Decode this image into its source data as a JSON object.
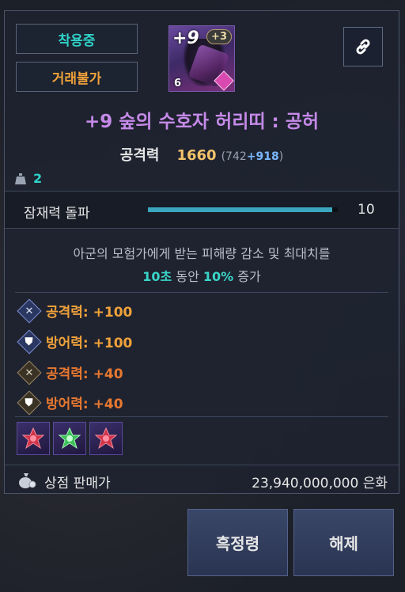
{
  "badges": {
    "equipped": "착용중",
    "untradable": "거래불가"
  },
  "item": {
    "plus_level": "+9",
    "plus_bonus": "+3",
    "tier": "6",
    "name": "+9 숲의 수호자 허리띠 : 공허"
  },
  "icons": {
    "link": "link-icon",
    "weight": "weight-icon",
    "attack": "crossed-swords-icon",
    "defense": "shield-icon",
    "money_bag": "money-bag-icon"
  },
  "stat": {
    "label": "공격력",
    "value": "1660",
    "base": "(742",
    "bonus": "+918",
    "close": ")"
  },
  "weight_value": "2",
  "potential": {
    "label": "잠재력 돌파",
    "value": "10",
    "fill_percent": 97
  },
  "description": {
    "line1": "아군의 모험가에게 받는 피해량 감소 및 최대치를",
    "seconds": "10초",
    "mid": " 동안 ",
    "percent": "10%",
    "end": " 증가"
  },
  "options": [
    {
      "label": "공격력: +100",
      "color": "#f0a23a",
      "icon": "crossed-swords-icon"
    },
    {
      "label": "방어력: +100",
      "color": "#f0a23a",
      "icon": "shield-icon"
    },
    {
      "label": "공격력: +40",
      "color": "#e8782f",
      "icon": "crossed-swords-icon"
    },
    {
      "label": "방어력: +40",
      "color": "#e8782f",
      "icon": "shield-icon"
    }
  ],
  "gems": [
    {
      "icon": "red-gem-icon",
      "color": "#d0344a"
    },
    {
      "icon": "green-gem-icon",
      "color": "#3cc05a"
    },
    {
      "icon": "red-gem-icon",
      "color": "#d0344a"
    }
  ],
  "sell": {
    "label": "상점 판매가",
    "value": "23,940,000,000 은화"
  },
  "buttons": {
    "left": "흑정령",
    "right": "해제"
  }
}
